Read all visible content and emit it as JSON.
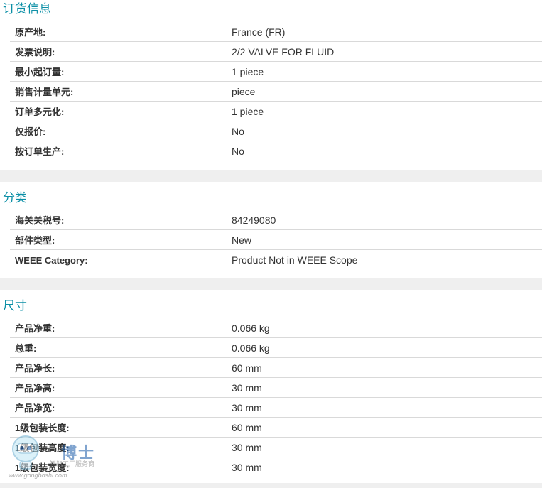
{
  "sections": [
    {
      "title": "订货信息",
      "rows": [
        {
          "label": "原产地:",
          "value": "France (FR)"
        },
        {
          "label": "发票说明:",
          "value": "2/2 VALVE FOR FLUID"
        },
        {
          "label": "最小起订量:",
          "value": "1 piece"
        },
        {
          "label": "销售计量单元:",
          "value": "piece"
        },
        {
          "label": "订单多元化:",
          "value": "1 piece"
        },
        {
          "label": "仅报价:",
          "value": "No"
        },
        {
          "label": "按订单生产:",
          "value": "No"
        }
      ]
    },
    {
      "title": "分类",
      "rows": [
        {
          "label": "海关关税号:",
          "value": "84249080"
        },
        {
          "label": "部件类型:",
          "value": "New"
        },
        {
          "label": "WEEE Category:",
          "value": "Product Not in WEEE Scope"
        }
      ]
    },
    {
      "title": "尺寸",
      "rows": [
        {
          "label": "产品净重:",
          "value": "0.066 kg"
        },
        {
          "label": "总重:",
          "value": "0.066 kg"
        },
        {
          "label": "产品净长:",
          "value": "60 mm"
        },
        {
          "label": "产品净高:",
          "value": "30 mm"
        },
        {
          "label": "产品净宽:",
          "value": "30 mm"
        },
        {
          "label": "1级包装长度:",
          "value": "60 mm"
        },
        {
          "label": "1级包装高度:",
          "value": "30 mm"
        },
        {
          "label": "1级包装宽度:",
          "value": "30 mm"
        }
      ]
    }
  ],
  "watermark": {
    "brand": "博士",
    "tagline": "智能工厂服务商",
    "url": "www.gongboshi.com"
  },
  "colors": {
    "section_title": "#0b8fa6",
    "divider": "#d9d9d9",
    "band": "#efefef"
  }
}
